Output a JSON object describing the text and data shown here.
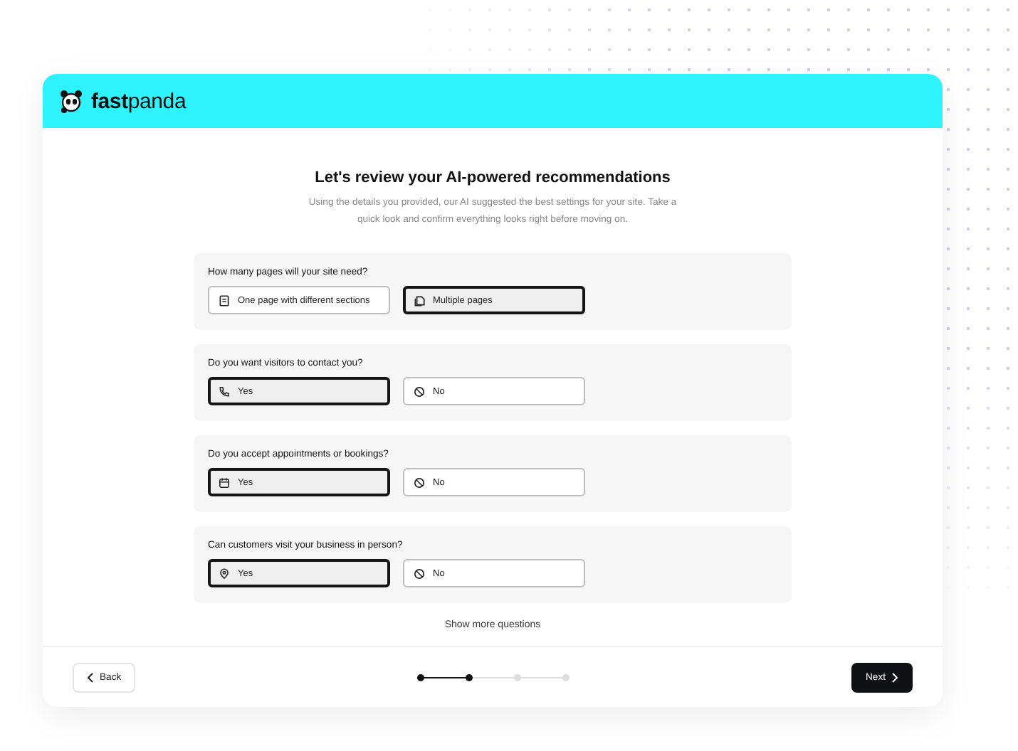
{
  "brand": {
    "name_bold": "fast",
    "name_light": "panda"
  },
  "heading": "Let's review your AI-powered recommendations",
  "subtitle": "Using the details you provided, our AI suggested the best settings for your site. Take a quick look and confirm everything looks right before moving on.",
  "questions": [
    {
      "label": "How many pages will your site need?",
      "options": [
        {
          "label": "One page with different sections",
          "kind": "page",
          "selected": false
        },
        {
          "label": "Multiple pages",
          "kind": "pages",
          "selected": true
        }
      ]
    },
    {
      "label": "Do you want visitors to contact you?",
      "options": [
        {
          "label": "Yes",
          "kind": "phone",
          "selected": true
        },
        {
          "label": "No",
          "kind": "ban",
          "selected": false
        }
      ]
    },
    {
      "label": "Do you accept appointments or bookings?",
      "options": [
        {
          "label": "Yes",
          "kind": "calendar",
          "selected": true
        },
        {
          "label": "No",
          "kind": "ban",
          "selected": false
        }
      ]
    },
    {
      "label": "Can customers visit your business in person?",
      "options": [
        {
          "label": "Yes",
          "kind": "pin",
          "selected": true
        },
        {
          "label": "No",
          "kind": "ban",
          "selected": false
        }
      ]
    }
  ],
  "show_more": "Show more questions",
  "footer": {
    "back": "Back",
    "next": "Next",
    "steps": [
      {
        "completed": true
      },
      {
        "completed": true
      },
      {
        "completed": false
      },
      {
        "completed": false
      }
    ]
  }
}
